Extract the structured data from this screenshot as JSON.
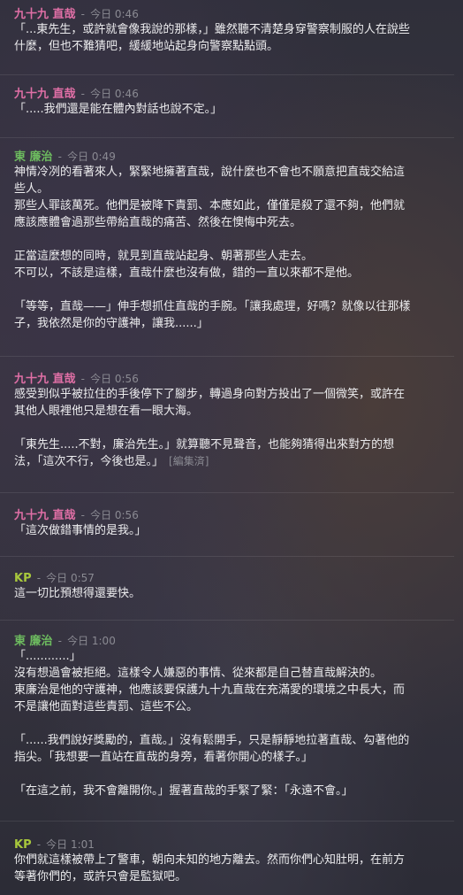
{
  "colors": {
    "author_jiu": "#e06fa6",
    "author_dong": "#6dbb5f",
    "author_kp": "#a8c83c",
    "text": "#ececee",
    "muted": "#8a8a92"
  },
  "messages": [
    {
      "author": "九十九 直哉",
      "sep": "-",
      "time": "今日 0:46",
      "lines": [
        "「...東先生，或許就會像我說的那樣，」雖然聽不清楚身穿警察制服的人在說些",
        "什麼，但也不難猜吧，緩緩地站起身向警察點點頭。"
      ]
    },
    {
      "author": "九十九 直哉",
      "sep": "-",
      "time": "今日 0:46",
      "lines": [
        "「.....我們還是能在體內對話也說不定。」"
      ]
    },
    {
      "author": "東 廉治",
      "sep": "-",
      "time": "今日 0:49",
      "lines": [
        "神情冷冽的看著來人，緊緊地擁著直哉，說什麼也不會也不願意把直哉交給這",
        "些人。",
        "那些人罪該萬死。他們是被降下責罰、本應如此，僅僅是殺了還不夠，他們就",
        "應該應體會過那些帶給直哉的痛苦、然後在懊悔中死去。",
        "",
        "正當這麼想的同時，就見到直哉站起身、朝著那些人走去。",
        "不可以，不該是這樣，直哉什麼也沒有做，錯的一直以來都不是他。",
        "",
        "「等等，直哉——」伸手想抓住直哉的手腕。「讓我處理，好嗎？就像以往那樣",
        "子，我依然是你的守護神，讓我......」"
      ]
    },
    {
      "author": "九十九 直哉",
      "sep": "-",
      "time": "今日 0:56",
      "lines": [
        "感受到似乎被拉住的手後停下了腳步，轉過身向對方投出了一個微笑，或許在",
        "其他人眼裡他只是想在看一眼大海。",
        "",
        "「東先生.....不對，廉治先生。」就算聽不見聲音，也能夠猜得出來對方的想",
        "法，「這次不行，今後也是。」"
      ],
      "edited": "[編集済]"
    },
    {
      "author": "九十九 直哉",
      "sep": "-",
      "time": "今日 0:56",
      "lines": [
        "「這次做錯事情的是我。」"
      ]
    },
    {
      "author": "KP",
      "sep": "-",
      "time": "今日 0:57",
      "lines": [
        "這一切比預想得還要快。"
      ]
    },
    {
      "author": "東 廉治",
      "sep": "-",
      "time": "今日 1:00",
      "lines": [
        "「............」",
        "沒有想過會被拒絕。這樣令人嫌惡的事情、從來都是自己替直哉解決的。",
        "東廉治是他的守護神，他應該要保護九十九直哉在充滿愛的環境之中長大，而",
        "不是讓他面對這些責罰、這些不公。",
        "",
        "「......我們說好獎勵的，直哉。」沒有鬆開手，只是靜靜地拉著直哉、勾著他的",
        "指尖。「我想要一直站在直哉的身旁，看著你開心的樣子。」",
        "",
        "「在這之前，我不會離開你。」握著直哉的手緊了緊：「永遠不會。」"
      ]
    },
    {
      "author": "KP",
      "sep": "-",
      "time": "今日 1:01",
      "lines": [
        "你們就這樣被帶上了警車，朝向未知的地方離去。然而你們心知肚明，在前方",
        "等著你們的，或許只會是監獄吧。"
      ]
    }
  ]
}
